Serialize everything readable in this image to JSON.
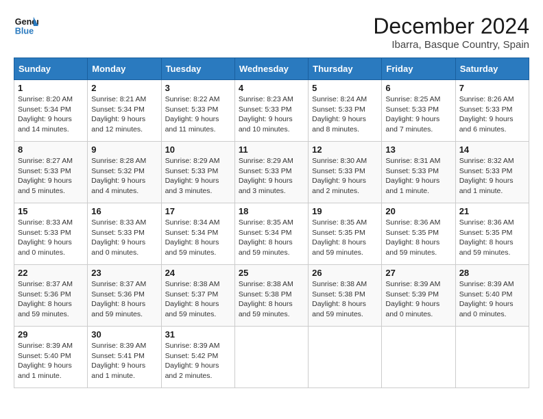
{
  "header": {
    "logo_line1": "General",
    "logo_line2": "Blue",
    "month": "December 2024",
    "location": "Ibarra, Basque Country, Spain"
  },
  "days_of_week": [
    "Sunday",
    "Monday",
    "Tuesday",
    "Wednesday",
    "Thursday",
    "Friday",
    "Saturday"
  ],
  "weeks": [
    [
      {
        "day": "1",
        "sunrise": "8:20 AM",
        "sunset": "5:34 PM",
        "daylight": "9 hours and 14 minutes."
      },
      {
        "day": "2",
        "sunrise": "8:21 AM",
        "sunset": "5:34 PM",
        "daylight": "9 hours and 12 minutes."
      },
      {
        "day": "3",
        "sunrise": "8:22 AM",
        "sunset": "5:33 PM",
        "daylight": "9 hours and 11 minutes."
      },
      {
        "day": "4",
        "sunrise": "8:23 AM",
        "sunset": "5:33 PM",
        "daylight": "9 hours and 10 minutes."
      },
      {
        "day": "5",
        "sunrise": "8:24 AM",
        "sunset": "5:33 PM",
        "daylight": "9 hours and 8 minutes."
      },
      {
        "day": "6",
        "sunrise": "8:25 AM",
        "sunset": "5:33 PM",
        "daylight": "9 hours and 7 minutes."
      },
      {
        "day": "7",
        "sunrise": "8:26 AM",
        "sunset": "5:33 PM",
        "daylight": "9 hours and 6 minutes."
      }
    ],
    [
      {
        "day": "8",
        "sunrise": "8:27 AM",
        "sunset": "5:33 PM",
        "daylight": "9 hours and 5 minutes."
      },
      {
        "day": "9",
        "sunrise": "8:28 AM",
        "sunset": "5:32 PM",
        "daylight": "9 hours and 4 minutes."
      },
      {
        "day": "10",
        "sunrise": "8:29 AM",
        "sunset": "5:33 PM",
        "daylight": "9 hours and 3 minutes."
      },
      {
        "day": "11",
        "sunrise": "8:29 AM",
        "sunset": "5:33 PM",
        "daylight": "9 hours and 3 minutes."
      },
      {
        "day": "12",
        "sunrise": "8:30 AM",
        "sunset": "5:33 PM",
        "daylight": "9 hours and 2 minutes."
      },
      {
        "day": "13",
        "sunrise": "8:31 AM",
        "sunset": "5:33 PM",
        "daylight": "9 hours and 1 minute."
      },
      {
        "day": "14",
        "sunrise": "8:32 AM",
        "sunset": "5:33 PM",
        "daylight": "9 hours and 1 minute."
      }
    ],
    [
      {
        "day": "15",
        "sunrise": "8:33 AM",
        "sunset": "5:33 PM",
        "daylight": "9 hours and 0 minutes."
      },
      {
        "day": "16",
        "sunrise": "8:33 AM",
        "sunset": "5:33 PM",
        "daylight": "9 hours and 0 minutes."
      },
      {
        "day": "17",
        "sunrise": "8:34 AM",
        "sunset": "5:34 PM",
        "daylight": "8 hours and 59 minutes."
      },
      {
        "day": "18",
        "sunrise": "8:35 AM",
        "sunset": "5:34 PM",
        "daylight": "8 hours and 59 minutes."
      },
      {
        "day": "19",
        "sunrise": "8:35 AM",
        "sunset": "5:35 PM",
        "daylight": "8 hours and 59 minutes."
      },
      {
        "day": "20",
        "sunrise": "8:36 AM",
        "sunset": "5:35 PM",
        "daylight": "8 hours and 59 minutes."
      },
      {
        "day": "21",
        "sunrise": "8:36 AM",
        "sunset": "5:35 PM",
        "daylight": "8 hours and 59 minutes."
      }
    ],
    [
      {
        "day": "22",
        "sunrise": "8:37 AM",
        "sunset": "5:36 PM",
        "daylight": "8 hours and 59 minutes."
      },
      {
        "day": "23",
        "sunrise": "8:37 AM",
        "sunset": "5:36 PM",
        "daylight": "8 hours and 59 minutes."
      },
      {
        "day": "24",
        "sunrise": "8:38 AM",
        "sunset": "5:37 PM",
        "daylight": "8 hours and 59 minutes."
      },
      {
        "day": "25",
        "sunrise": "8:38 AM",
        "sunset": "5:38 PM",
        "daylight": "8 hours and 59 minutes."
      },
      {
        "day": "26",
        "sunrise": "8:38 AM",
        "sunset": "5:38 PM",
        "daylight": "8 hours and 59 minutes."
      },
      {
        "day": "27",
        "sunrise": "8:39 AM",
        "sunset": "5:39 PM",
        "daylight": "9 hours and 0 minutes."
      },
      {
        "day": "28",
        "sunrise": "8:39 AM",
        "sunset": "5:40 PM",
        "daylight": "9 hours and 0 minutes."
      }
    ],
    [
      {
        "day": "29",
        "sunrise": "8:39 AM",
        "sunset": "5:40 PM",
        "daylight": "9 hours and 1 minute."
      },
      {
        "day": "30",
        "sunrise": "8:39 AM",
        "sunset": "5:41 PM",
        "daylight": "9 hours and 1 minute."
      },
      {
        "day": "31",
        "sunrise": "8:39 AM",
        "sunset": "5:42 PM",
        "daylight": "9 hours and 2 minutes."
      },
      null,
      null,
      null,
      null
    ]
  ],
  "labels": {
    "sunrise": "Sunrise:",
    "sunset": "Sunset:",
    "daylight": "Daylight:"
  }
}
